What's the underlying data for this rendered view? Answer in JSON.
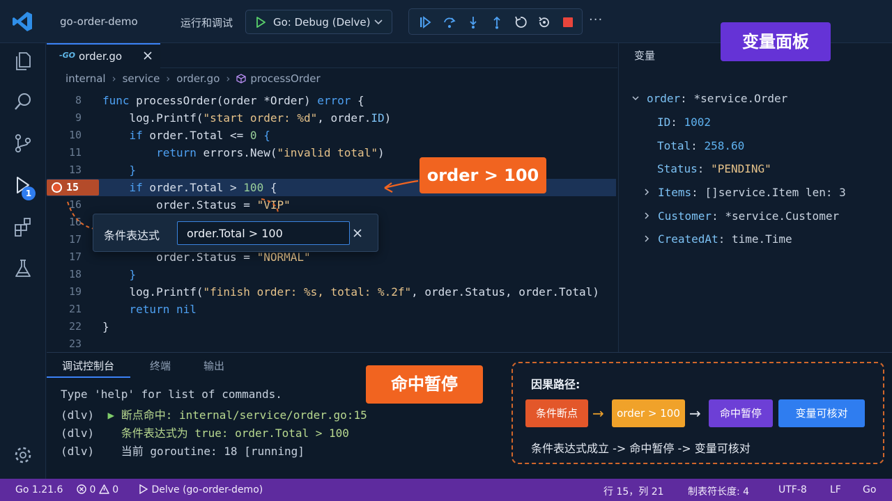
{
  "titlebar": {
    "workspace": "go-order-demo",
    "run_debug": "运行和调试",
    "debug_config": "Go: Debug (Delve)",
    "more": "···"
  },
  "activity": {
    "debug_badge": "1"
  },
  "editor": {
    "tab_icon": "-GO",
    "tab_label": "order.go",
    "breadcrumb": [
      "internal",
      "service",
      "order.go",
      "processOrder"
    ],
    "breakpoint_line": "15",
    "lines": [
      {
        "n": "8",
        "code": "func processOrder(order *Order) error {"
      },
      {
        "n": "9",
        "code": "    log.Printf(\"start order: %d\", order.ID)"
      },
      {
        "n": "10",
        "code": "    if order.Total <= 0 {"
      },
      {
        "n": "11",
        "code": "        return errors.New(\"invalid total\")"
      },
      {
        "n": "13",
        "code": "    }"
      },
      {
        "n": "15",
        "code": "    if order.Total > 100 {"
      },
      {
        "n": "16",
        "code": "        order.Status = \"VIP\""
      },
      {
        "n": "16",
        "code": ""
      },
      {
        "n": "17",
        "code": ""
      },
      {
        "n": "17",
        "code": "        order.Status = \"NORMAL\""
      },
      {
        "n": "18",
        "code": "    }"
      },
      {
        "n": "19",
        "code": "    log.Printf(\"finish order: %s, total: %.2f\", order.Status, order.Total)"
      },
      {
        "n": "21",
        "code": "    return nil"
      },
      {
        "n": "22",
        "code": "}"
      },
      {
        "n": "23",
        "code": ""
      }
    ]
  },
  "condition": {
    "label": "条件表达式",
    "value": "order.Total > 100"
  },
  "variables": {
    "title": "变量",
    "order_name": "order",
    "order_type": "*service.Order",
    "id_key": "ID",
    "id_val": "1002",
    "total_key": "Total",
    "total_val": "258.60",
    "status_key": "Status",
    "status_val": "\"PENDING\"",
    "items_key": "Items",
    "items_val": "[]service.Item len: 3",
    "customer_key": "Customer",
    "customer_val": "*service.Customer",
    "created_key": "CreatedAt",
    "created_val": "time.Time"
  },
  "panel": {
    "tabs": [
      "调试控制台",
      "终端",
      "输出"
    ],
    "console": {
      "line1": "Type 'help' for list of commands.",
      "prompt": "(dlv)",
      "line2_tri": "▶",
      "line2": "断点命中: internal/service/order.go:15",
      "line3": "条件表达式为 true: order.Total > 100",
      "line4": "当前 goroutine: 18 [running]"
    }
  },
  "causal": {
    "title": "因果路径:",
    "chips": [
      "条件断点",
      "order > 100",
      "命中暂停",
      "变量可核对"
    ],
    "summary": "条件表达式成立 -> 命中暂停 -> 变量可核对"
  },
  "callouts": {
    "vars": "变量面板",
    "cond": "order > 100",
    "hit": "命中暂停"
  },
  "statusbar": {
    "go_version": "Go 1.21.6",
    "errors": "0",
    "warnings": "0",
    "debugger": "Delve (go-order-demo)",
    "position": "行 15，列 21",
    "tab_size": "制表符长度: 4",
    "encoding": "UTF-8",
    "eol": "LF",
    "language": "Go"
  },
  "colors": {
    "accent": "#3b82f6",
    "breakpoint": "#e3562f",
    "callout_orange": "#f16420",
    "callout_purple": "#6533d6",
    "statusbar": "#5e2b9e"
  }
}
